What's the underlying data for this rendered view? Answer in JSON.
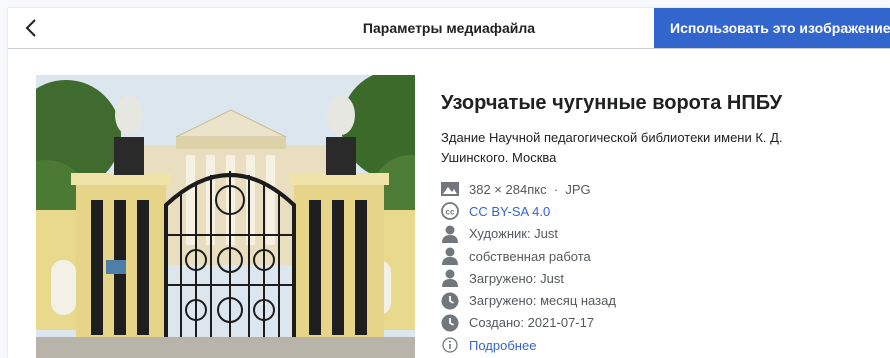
{
  "header": {
    "title": "Параметры медиафайла",
    "use_button": "Использовать это изображение"
  },
  "media": {
    "title": "Узорчатые чугунные ворота НПБУ",
    "description": "Здание Научной педагогической библиотеки имени К. Д. Ушинского. Москва",
    "size": "382 × 284пкс",
    "separator": "·",
    "format": "JPG",
    "license": "CC BY-SA 4.0",
    "artist": "Художник: Just",
    "source": "собственная работа",
    "uploader": "Загружено: Just",
    "uploaded_when": "Загружено: месяц назад",
    "created": "Создано: 2021-07-17",
    "more": "Подробнее"
  },
  "icons": {
    "back": "chevron-left-icon",
    "size": "image-icon",
    "license": "cc-icon",
    "artist": "user-icon",
    "source": "user-icon",
    "uploader": "user-icon",
    "uploaded_when": "clock-icon",
    "created": "clock-icon",
    "more": "info-icon"
  },
  "colors": {
    "accent": "#3366cc",
    "text": "#202122",
    "muted": "#54595d",
    "icon": "#72777d"
  }
}
